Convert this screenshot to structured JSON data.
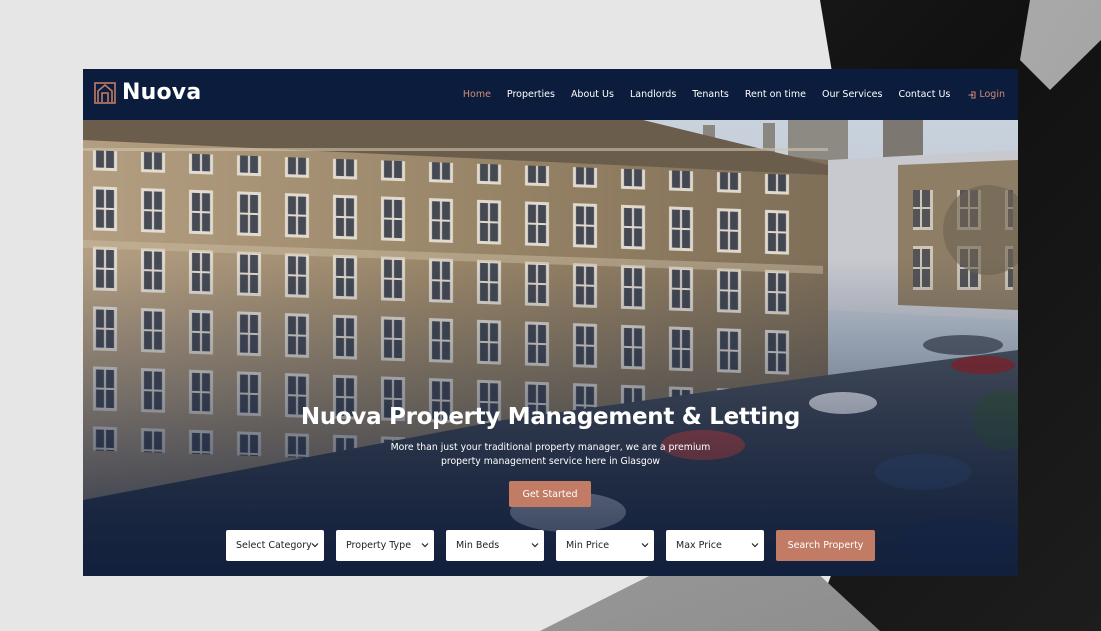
{
  "brand": {
    "name": "Nuova",
    "accent": "#c27c66",
    "navy": "#0c1c3c"
  },
  "nav": {
    "items": [
      {
        "label": "Home",
        "active": true
      },
      {
        "label": "Properties"
      },
      {
        "label": "About Us"
      },
      {
        "label": "Landlords"
      },
      {
        "label": "Tenants"
      },
      {
        "label": "Rent on time"
      },
      {
        "label": "Our Services"
      },
      {
        "label": "Contact Us"
      }
    ],
    "login": {
      "label": "Login",
      "icon": "login-icon"
    }
  },
  "hero": {
    "title": "Nuova Property Management & Letting",
    "subtitle_line1": "More than just your traditional property manager, we are a premium",
    "subtitle_line2": "property management service here in Glasgow",
    "cta_label": "Get Started"
  },
  "search": {
    "filters": [
      {
        "selected": "Select Category"
      },
      {
        "selected": "Property Type"
      },
      {
        "selected": "Min Beds"
      },
      {
        "selected": "Min Price"
      },
      {
        "selected": "Max Price"
      }
    ],
    "button_label": "Search Property"
  }
}
